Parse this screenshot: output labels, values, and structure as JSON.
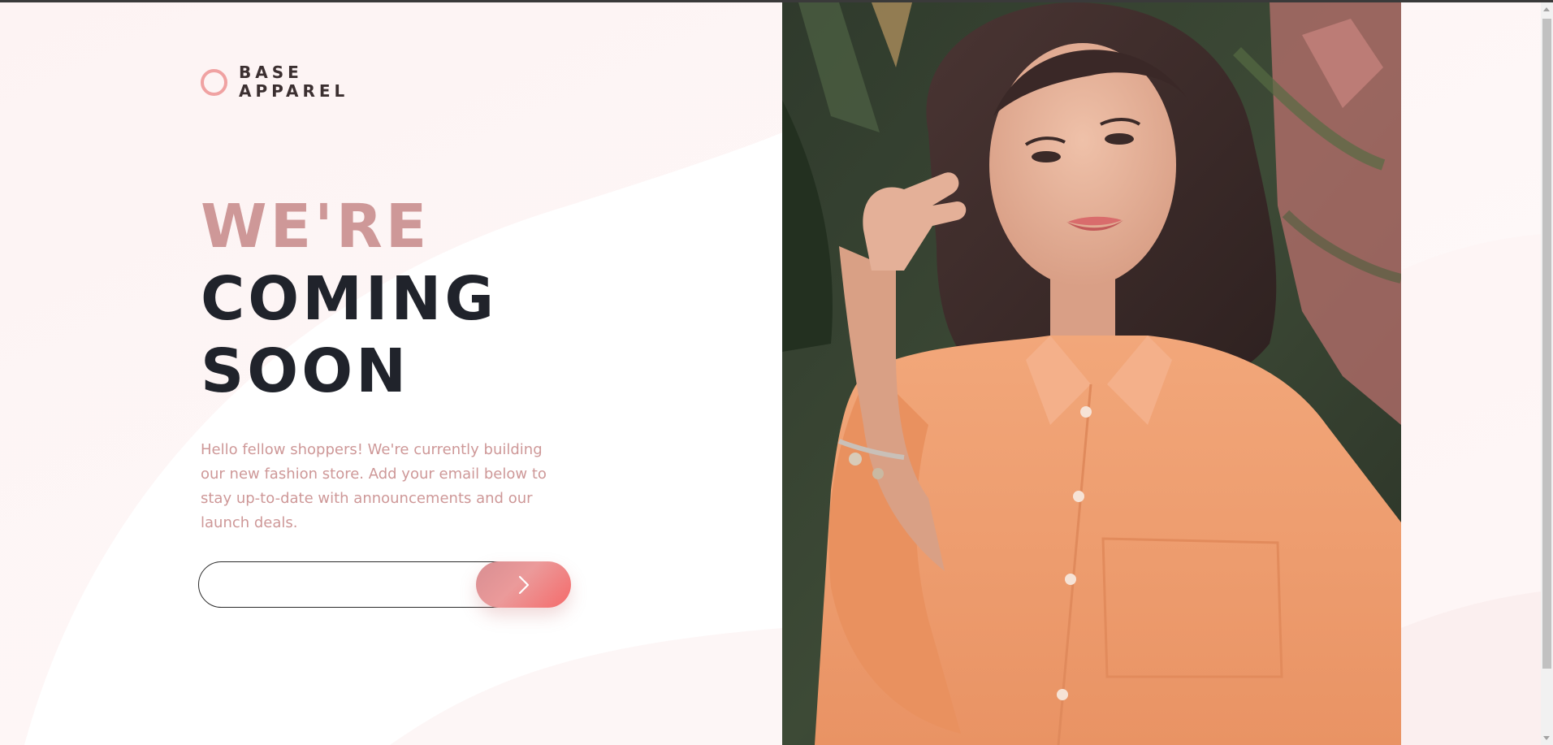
{
  "brand": {
    "line1": "BASE",
    "line2": "APPAREL",
    "logo_icon": "ring-icon"
  },
  "hero": {
    "headline_light": "WE'RE",
    "headline_dark_1": "COMING",
    "headline_dark_2": "SOON",
    "description": "Hello fellow shoppers! We're currently building our new fashion store. Add your email below to stay up-to-date with announcements and our launch deals."
  },
  "signup": {
    "email_value": "",
    "email_placeholder": "",
    "submit_icon": "chevron-right-icon"
  },
  "image": {
    "subject": "hero-photo"
  },
  "colors": {
    "accent": "#ce9898",
    "dark": "#20232b",
    "button_gradient_start": "#d88e92",
    "button_gradient_end": "#f56a6a",
    "logo_ring": "#f0a2a2",
    "background": "#fdf7f7"
  }
}
